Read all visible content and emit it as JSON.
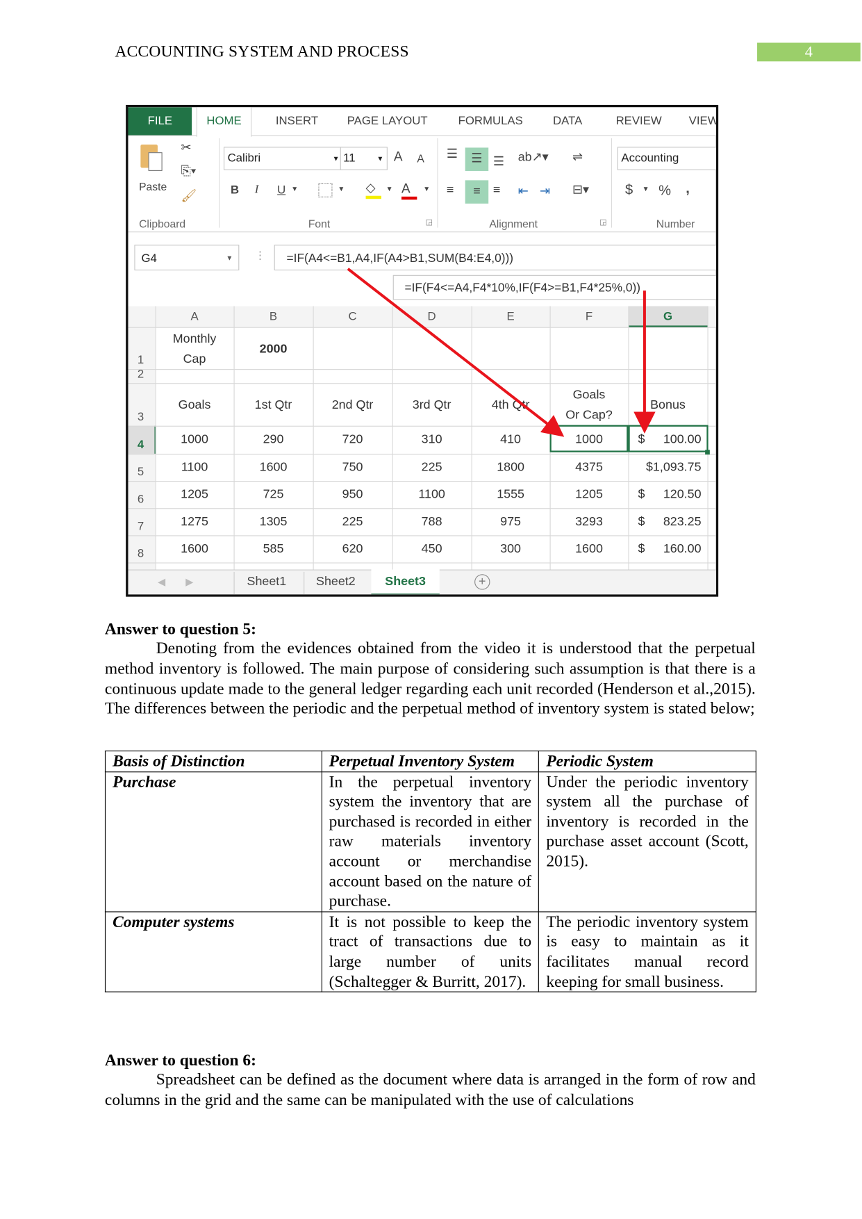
{
  "header": {
    "title": "ACCOUNTING SYSTEM AND PROCESS",
    "page_number": "4",
    "page_number_bg": "#9bcf6a"
  },
  "excel": {
    "accent": "#217346",
    "ribbon_tabs": [
      "FILE",
      "HOME",
      "INSERT",
      "PAGE LAYOUT",
      "FORMULAS",
      "DATA",
      "REVIEW",
      "VIEW"
    ],
    "active_tab": "HOME",
    "clipboard": {
      "paste_label": "Paste",
      "group_label": "Clipboard"
    },
    "font": {
      "name": "Calibri",
      "size": "11",
      "group_label": "Font",
      "bold": "B",
      "italic": "I",
      "underline": "U",
      "font_color": "A",
      "grow": "A",
      "shrink": "A"
    },
    "alignment": {
      "group_label": "Alignment"
    },
    "number": {
      "format": "Accounting",
      "group_label": "Number",
      "currency": "$",
      "percent": "%",
      "comma": ","
    },
    "name_box": "G4",
    "formula": "=IF(A4<=B1,A4,IF(A4>B1,SUM(B4:E4,0)))",
    "formula_callout": "=IF(F4<=A4,F4*10%,IF(F4>=B1,F4*25%,0))",
    "columns": [
      "A",
      "B",
      "C",
      "D",
      "E",
      "F",
      "G"
    ],
    "row_numbers": [
      "1",
      "2",
      "3",
      "4",
      "5",
      "6",
      "7",
      "8"
    ],
    "row1": {
      "a_line1": "Monthly",
      "a_line2": "Cap",
      "b": "2000"
    },
    "headers": {
      "a": "Goals",
      "b": "1st Qtr",
      "c": "2nd Qtr",
      "d": "3rd Qtr",
      "e": "4th Qtr",
      "f_line1": "Goals",
      "f_line2": "Or Cap?",
      "g": "Bonus"
    },
    "rows": [
      [
        "1000",
        "290",
        "720",
        "310",
        "410",
        "1000",
        "$",
        "100.00"
      ],
      [
        "1100",
        "1600",
        "750",
        "225",
        "1800",
        "4375",
        "",
        "$1,093.75"
      ],
      [
        "1205",
        "725",
        "950",
        "1100",
        "1555",
        "1205",
        "$",
        "120.50"
      ],
      [
        "1275",
        "1305",
        "225",
        "788",
        "975",
        "3293",
        "$",
        "823.25"
      ],
      [
        "1600",
        "585",
        "620",
        "450",
        "300",
        "1600",
        "$",
        "160.00"
      ]
    ],
    "sheets": [
      "Sheet1",
      "Sheet2",
      "Sheet3"
    ],
    "active_sheet": "Sheet3",
    "arrow_color": "#e8141c"
  },
  "q5": {
    "heading": "Answer to question 5:",
    "paragraph": "Denoting from the evidences obtained from the video it is understood that the perpetual method inventory is followed. The main purpose of considering such assumption is that there is a continuous update made to the general ledger regarding each unit recorded (Henderson et al.,2015). The differences between the periodic and the perpetual method of inventory system is stated below;",
    "table": {
      "headers": [
        "Basis of Distinction",
        "Perpetual Inventory System",
        "Periodic System"
      ],
      "rows": [
        [
          "Purchase",
          "In the perpetual inventory system the inventory that are purchased is recorded in either raw materials inventory account or merchandise account based on the nature of purchase.",
          "Under the periodic inventory system all the purchase of inventory is recorded in the purchase asset account (Scott, 2015)."
        ],
        [
          "Computer systems",
          "It is not possible to keep the tract of transactions due to large number of units (Schaltegger & Burritt, 2017).",
          "The periodic inventory system is easy to maintain as it facilitates manual record keeping for small business."
        ]
      ]
    }
  },
  "q6": {
    "heading": "Answer to question 6:",
    "paragraph": "Spreadsheet can be defined as the document where data is arranged in the form of row and columns in the grid and the same can be manipulated with the use of calculations"
  }
}
